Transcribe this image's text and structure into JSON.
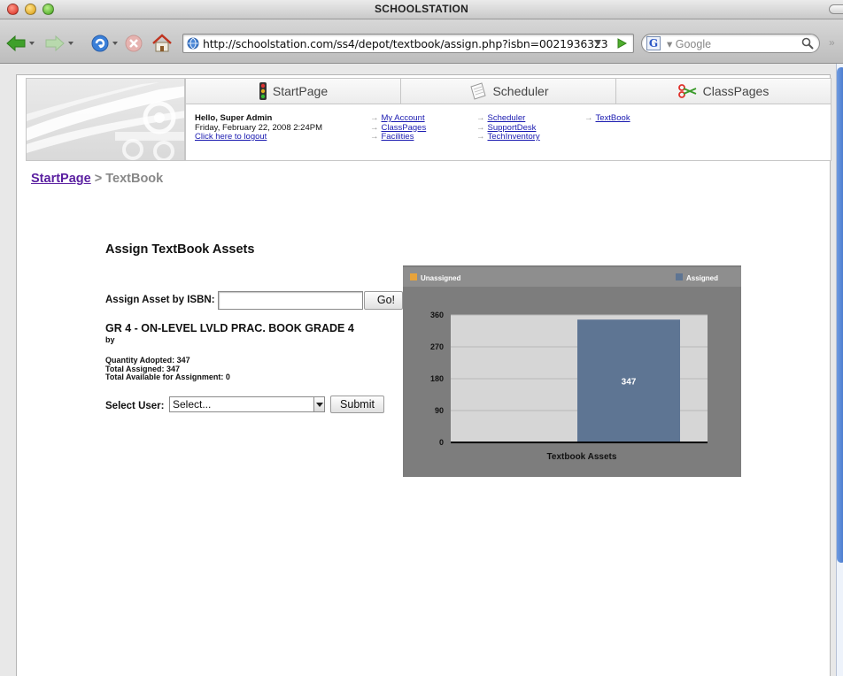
{
  "window": {
    "title": "SCHOOLSTATION"
  },
  "toolbar": {
    "url": "http://schoolstation.com/ss4/depot/textbook/assign.php?isbn=0021936323",
    "search_placeholder": "Google"
  },
  "nav": {
    "tabs": [
      {
        "label": "StartPage",
        "icon": "traffic-light-icon"
      },
      {
        "label": "Scheduler",
        "icon": "notepad-icon"
      },
      {
        "label": "ClassPages",
        "icon": "scissors-icon"
      }
    ]
  },
  "user": {
    "greeting": "Hello, Super Admin",
    "datetime": "Friday, February 22, 2008 2:24PM",
    "logout": "Click here to logout"
  },
  "quick_links": {
    "col1": [
      "My Account",
      "ClassPages",
      "Facilities"
    ],
    "col2": [
      "Scheduler",
      "SupportDesk",
      "TechInventory"
    ],
    "col3": [
      "TextBook"
    ]
  },
  "breadcrumb": {
    "root": "StartPage",
    "separator": ">",
    "current": "TextBook"
  },
  "form": {
    "title": "Assign TextBook Assets",
    "isbn_label": "Assign Asset by ISBN:",
    "isbn_value": "",
    "go_label": "Go!",
    "book_title": "GR 4 - ON-LEVEL LVLD PRAC. BOOK GRADE 4",
    "book_by": "by",
    "quantity_adopted": "Quantity Adopted: 347",
    "total_assigned": "Total Assigned: 347",
    "total_available": "Total Available for Assignment: 0",
    "user_label": "Select User:",
    "user_value": "Select...",
    "submit_label": "Submit"
  },
  "chart_data": {
    "type": "bar",
    "categories": [
      "Textbook Assets"
    ],
    "series": [
      {
        "name": "Unassigned",
        "values": [
          0
        ],
        "color": "#e8a33a"
      },
      {
        "name": "Assigned",
        "values": [
          347
        ],
        "color": "#5e7593"
      }
    ],
    "yticks": [
      0,
      90,
      180,
      270,
      360
    ],
    "ylim": [
      0,
      360
    ],
    "xlabel": "Textbook Assets",
    "bar_label": "347",
    "legend": "top",
    "grid": true
  },
  "colors": {
    "chart_bg": "#7d7d7d",
    "plot_bg": "#d6d6d6",
    "link": "#1a1ab0",
    "breadcrumb_link": "#5a1fa0"
  }
}
